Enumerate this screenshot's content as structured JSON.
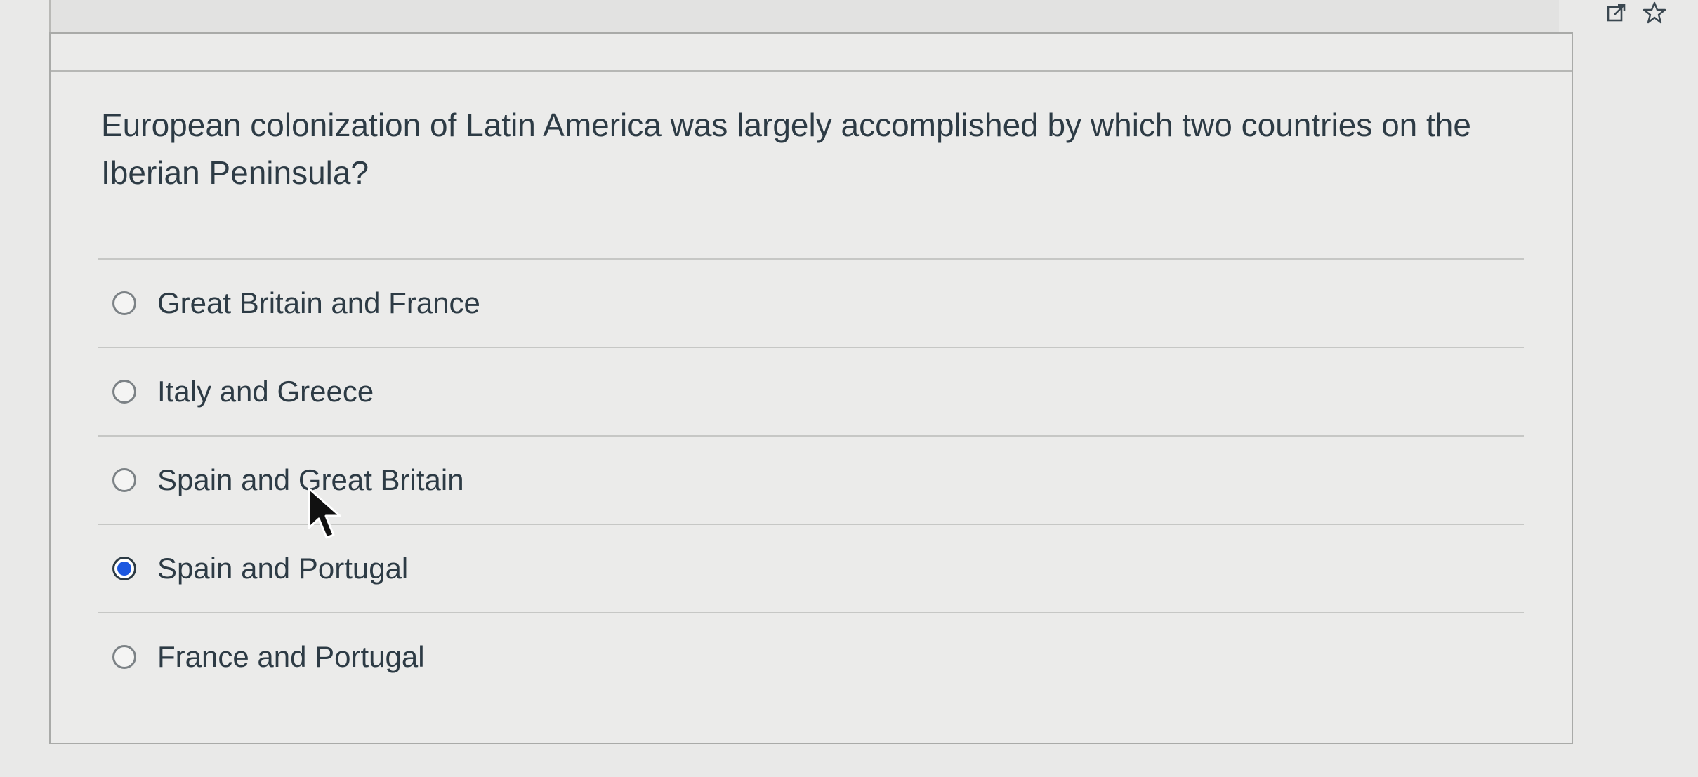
{
  "toolbar": {
    "icons": [
      "external-link-icon",
      "star-icon"
    ]
  },
  "question": {
    "text": "European colonization of Latin America was largely accomplished by which two countries on the Iberian Peninsula?"
  },
  "answers": [
    {
      "label": "Great Britain and France",
      "selected": false
    },
    {
      "label": "Italy and Greece",
      "selected": false
    },
    {
      "label": "Spain and Great Britain",
      "selected": false
    },
    {
      "label": "Spain and Portugal",
      "selected": true
    },
    {
      "label": "France and Portugal",
      "selected": false
    }
  ],
  "colors": {
    "accent": "#1b57e0",
    "text": "#2d3b45",
    "background": "#ebebea"
  }
}
